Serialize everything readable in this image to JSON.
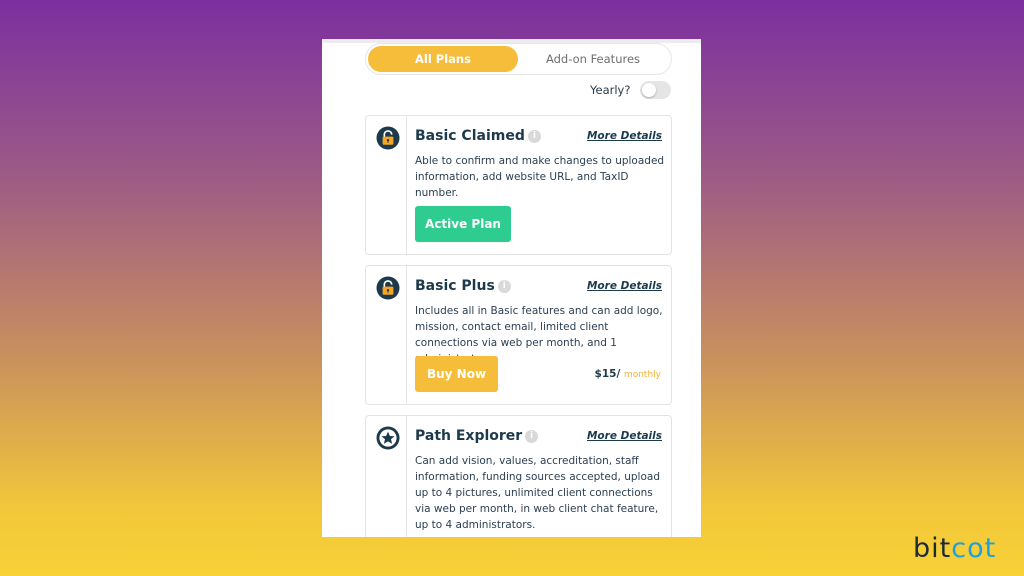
{
  "tabs": [
    {
      "label": "All Plans",
      "active": true
    },
    {
      "label": "Add-on Features",
      "active": false
    }
  ],
  "billing": {
    "label": "Yearly?",
    "yearly_enabled": false
  },
  "plans": [
    {
      "name": "Basic Claimed",
      "icon": "padlock-icon",
      "details_link": "More Details",
      "description": "Able to confirm and make changes to uploaded information, add website URL, and TaxID number.",
      "button_label": "Active Plan",
      "button_color": "#2ecc8f"
    },
    {
      "name": "Basic Plus",
      "icon": "padlock-icon",
      "details_link": "More Details",
      "description": "Includes all in Basic features and can add logo, mission, contact email, limited client connections via web per month, and 1 administrator.",
      "button_label": "Buy Now",
      "button_color": "#f6bd3b",
      "price": "$15/",
      "price_period": "monthly"
    },
    {
      "name": "Path Explorer",
      "icon": "star-badge-icon",
      "details_link": "More Details",
      "description": "Can add vision, values, accreditation, staff information, funding sources accepted, upload up to 4 pictures, unlimited client connections via web per month, in web client chat feature, up to 4 administrators."
    }
  ],
  "brand": {
    "logo_part1": "bit",
    "logo_part2": "cot",
    "accent_color": "#1da1dd"
  }
}
